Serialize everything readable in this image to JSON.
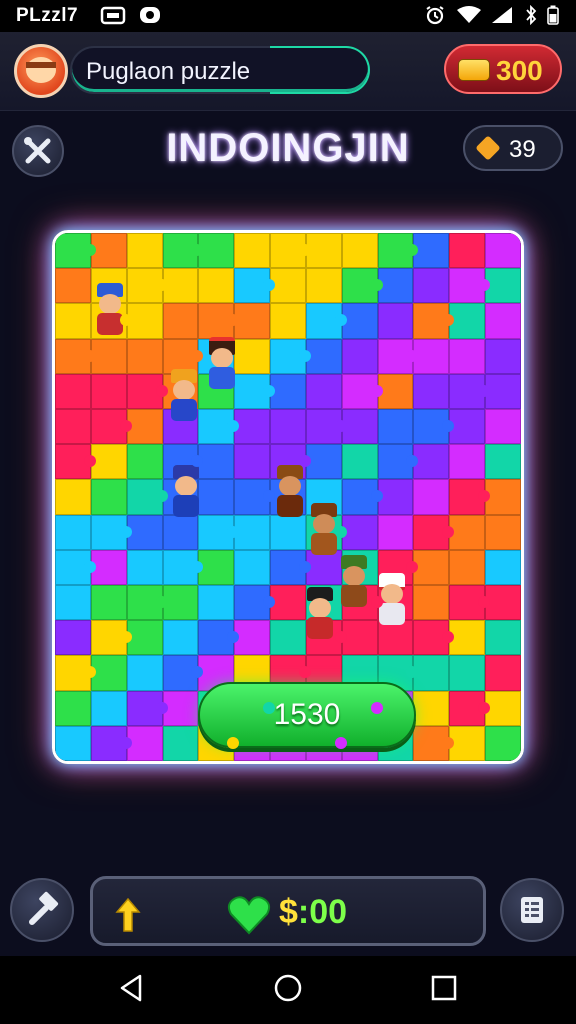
{
  "status_bar": {
    "time": "PLzzl7"
  },
  "top_bar": {
    "player_name": "Puglaon puzzle",
    "coins": "300"
  },
  "header": {
    "level_title": "INDOINGJIN",
    "gems": "39"
  },
  "board": {
    "play_value": "1530"
  },
  "bottom_bar": {
    "value_currency": "$",
    "value_amount": ":00"
  },
  "icons": {
    "avatar": "avatar-icon",
    "coin": "coin-icon",
    "tools": "crossed-tools-icon",
    "gem": "gem-icon",
    "hammer": "hammer-icon",
    "arrow": "up-arrow-icon",
    "heart": "green-heart-icon",
    "menu": "list-icon",
    "back": "back-triangle-icon",
    "home": "home-circle-icon",
    "recents": "recents-square-icon"
  },
  "colors": {
    "play_button": "#2bd84a",
    "coin_pill": "#b3202b",
    "title_glow": "#b38bff",
    "board_glow_blue": "#6ad8ff",
    "board_glow_purple": "#c04dff",
    "value_yellow": "#ffe13a"
  }
}
